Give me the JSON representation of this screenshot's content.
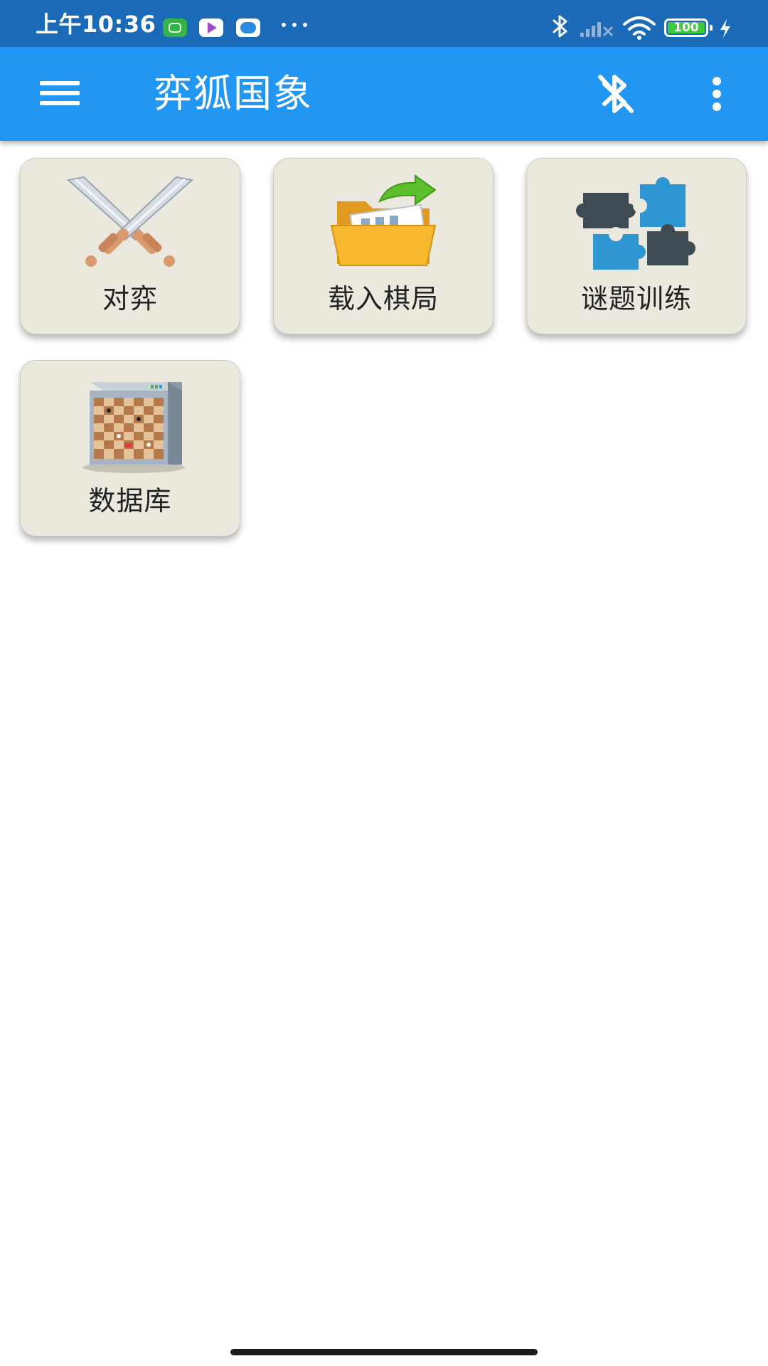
{
  "status_bar": {
    "time": "上午10:36",
    "battery_level": "100",
    "icons": [
      "notification-app-icon",
      "video-app-icon",
      "message-app-icon",
      "more-notifications-icon",
      "bluetooth-icon",
      "no-signal-icon",
      "wifi-icon",
      "battery-icon",
      "charging-icon"
    ]
  },
  "app_bar": {
    "title": "弈狐国象",
    "icons": [
      "menu-icon",
      "bluetooth-disabled-icon",
      "overflow-menu-icon"
    ],
    "color": "#2196f3"
  },
  "tiles": [
    {
      "label": "对弈",
      "icon": "crossed-swords-icon"
    },
    {
      "label": "载入棋局",
      "icon": "open-folder-icon"
    },
    {
      "label": "谜题训练",
      "icon": "puzzle-pieces-icon"
    },
    {
      "label": "数据库",
      "icon": "chess-database-icon"
    }
  ],
  "colors": {
    "status_bar": "#1b6ab8",
    "tile_background": "#ebe8de",
    "puzzle_blue": "#2e96d2",
    "puzzle_dark": "#3f4b52",
    "folder_yellow": "#f5b82e",
    "arrow_green": "#5cc02c"
  }
}
